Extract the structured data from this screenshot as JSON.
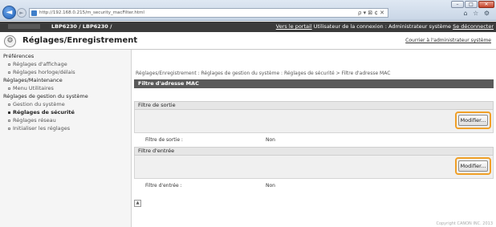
{
  "browser": {
    "url": "http://192.168.0.215/m_security_macFilter.html",
    "addr_controls": "ρ ▾ ⊠ ¢ ✕",
    "toolbar_icons": "⌂ ☆ ⚙",
    "win_min": "–",
    "win_max": "□",
    "win_close": "✕"
  },
  "header": {
    "model": "LBP6230 / LBP6230 /",
    "portal_link": "Vers le portail",
    "login_text": "Utilisateur de la connexion : Administrateur système",
    "logout_link": "Se déconnecter"
  },
  "title": {
    "text": "Réglages/Enregistrement",
    "contact_link": "Courrier à l'administrateur système"
  },
  "sidebar": {
    "sections": [
      {
        "heading": "Préférences",
        "items": [
          {
            "label": "Réglages d'affichage"
          },
          {
            "label": "Réglages horloge/délais"
          }
        ]
      },
      {
        "heading": "Réglages/Maintenance",
        "items": [
          {
            "label": "Menu Utilitaires"
          }
        ]
      },
      {
        "heading": "Réglages de gestion du système",
        "items": [
          {
            "label": "Gestion du système"
          },
          {
            "label": "Réglages de sécurité"
          },
          {
            "label": "Réglages réseau"
          },
          {
            "label": "Initialiser les réglages"
          }
        ]
      }
    ]
  },
  "main": {
    "breadcrumb": "Réglages/Enregistrement : Réglages de gestion du système : Réglages de sécurité > Filtre d'adresse MAC",
    "page_title": "Filtre d'adresse MAC",
    "outbound": {
      "heading": "Filtre de sortie",
      "button": "Modifier...",
      "label": "Filtre de sortie :",
      "value": "Non"
    },
    "inbound": {
      "heading": "Filtre d'entrée",
      "button": "Modifier...",
      "label": "Filtre d'entrée :",
      "value": "Non"
    },
    "to_top": "▲",
    "copyright": "Copyright CANON INC. 2013"
  }
}
